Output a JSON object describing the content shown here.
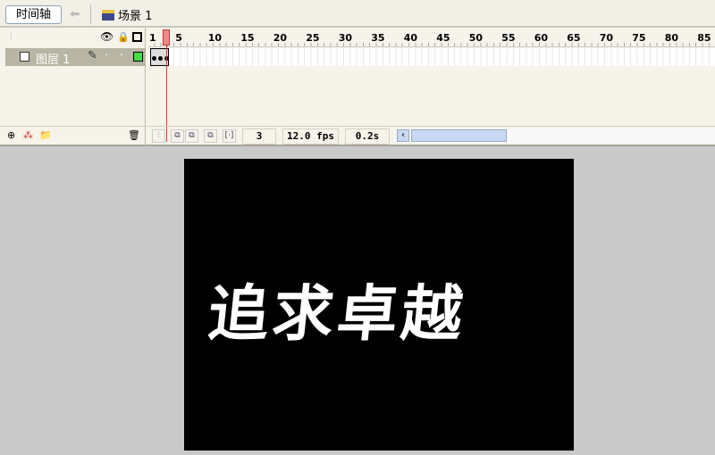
{
  "topbar": {
    "timeline_button": "时间轴",
    "back_icon": "arrow-left-icon",
    "scene_icon": "clapperboard-icon",
    "scene_label": "场景 1"
  },
  "timeline": {
    "header_icons": [
      "eye-icon",
      "lock-icon",
      "outline-square-icon"
    ],
    "ruler_ticks": [
      "1",
      "5",
      "10",
      "15",
      "20",
      "25",
      "30",
      "35",
      "40",
      "45",
      "50",
      "55",
      "60",
      "65",
      "70",
      "75",
      "80",
      "85"
    ],
    "current_frame_marker": 3,
    "layer": {
      "name": "图层 1",
      "icon": "layer-page-icon",
      "edit_icon": "pencil-icon",
      "outline_color": "#44dd44"
    },
    "keyframes": 3,
    "status": {
      "frame": "3",
      "fps": "12.0 fps",
      "time": "0.2s"
    }
  },
  "stage": {
    "text": "追求卓越",
    "background": "#000000"
  }
}
